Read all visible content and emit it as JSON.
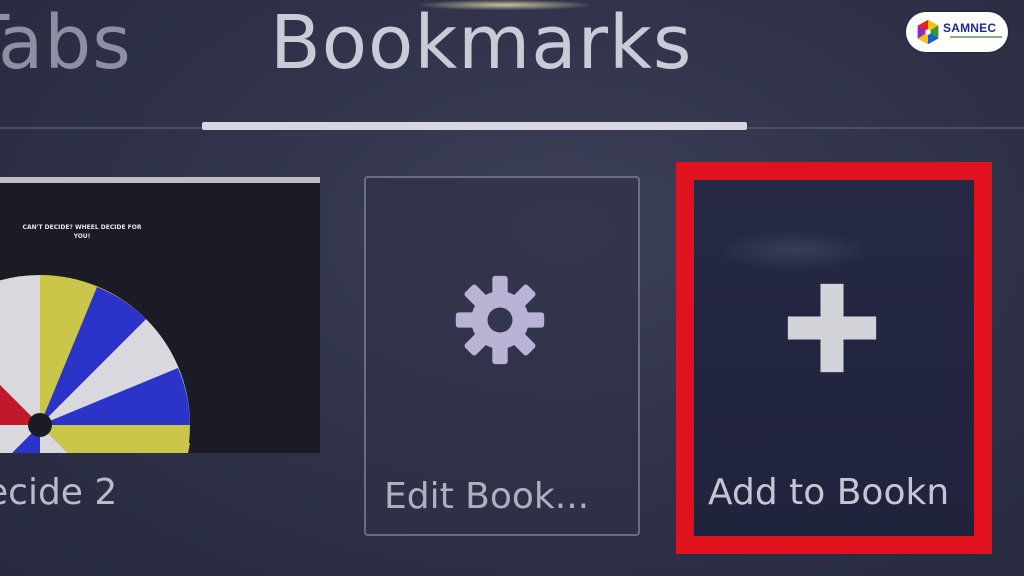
{
  "tabs": {
    "tabs_label": "Tabs",
    "bookmarks_label": "Bookmarks"
  },
  "bookmarks": [
    {
      "label": "ecide 2",
      "thumbnail_text": "CAN'T DECIDE? WHEEL DECIDE FOR YOU!"
    },
    {
      "label": "Edit Book...",
      "icon": "gear-icon"
    },
    {
      "label": "Add to Bookn",
      "icon": "plus-icon",
      "highlight_color": "#e0121d"
    }
  ],
  "logo": {
    "text": "SAMNEC"
  },
  "colors": {
    "background": "#2e3148",
    "active_underline": "#d6d7df",
    "highlight": "#e0121d"
  }
}
